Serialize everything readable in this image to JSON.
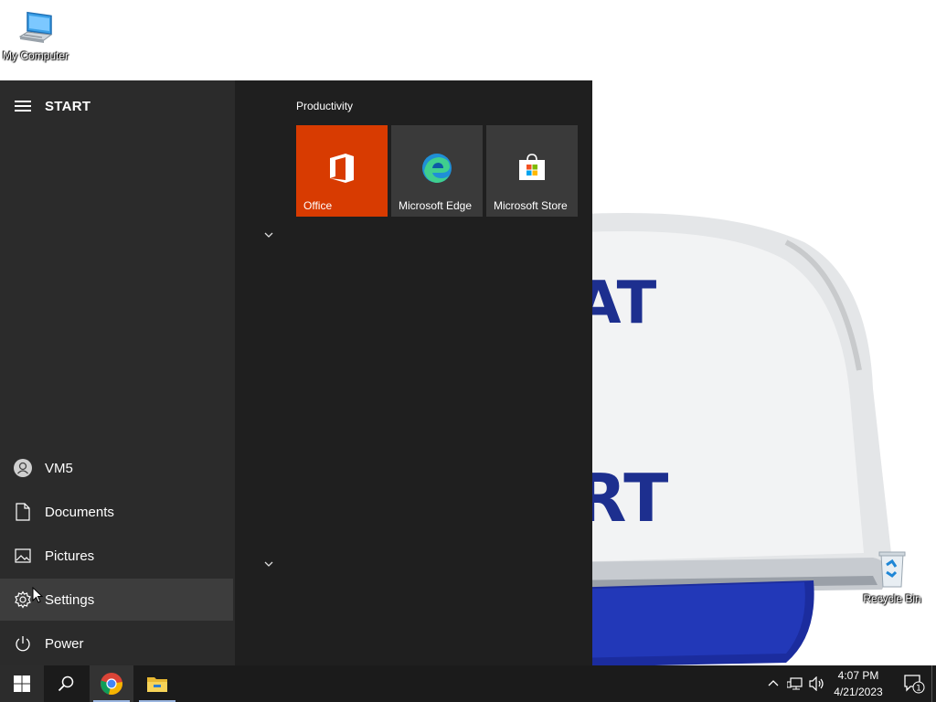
{
  "desktop": {
    "icons": [
      {
        "label": "My Computer",
        "icon": "computer-icon"
      },
      {
        "label": "Recycle Bin",
        "icon": "recycle-bin-icon"
      }
    ],
    "wallpaper_text": [
      "AT",
      "RT"
    ]
  },
  "start_menu": {
    "title": "START",
    "user": "VM5",
    "items": [
      {
        "label": "Documents",
        "icon": "document-icon"
      },
      {
        "label": "Pictures",
        "icon": "picture-icon"
      },
      {
        "label": "Settings",
        "icon": "gear-icon"
      },
      {
        "label": "Power",
        "icon": "power-icon"
      }
    ],
    "group_title": "Productivity",
    "tiles": [
      {
        "label": "Office",
        "icon": "office-icon",
        "color": "#d83b01"
      },
      {
        "label": "Microsoft Edge",
        "icon": "edge-icon",
        "color": "#3a3a3a"
      },
      {
        "label": "Microsoft Store",
        "icon": "store-icon",
        "color": "#3a3a3a"
      }
    ]
  },
  "taskbar": {
    "apps": [
      "windows-start-icon",
      "search-icon",
      "chrome-icon",
      "file-explorer-icon"
    ],
    "tray": [
      "chevron-up-icon",
      "network-icon",
      "volume-icon"
    ],
    "time": "4:07 PM",
    "date": "4/21/2023",
    "notification_count": "1"
  },
  "colors": {
    "accent": "#d83b01",
    "start_left": "#2b2b2b",
    "start_right": "#1f1f1f",
    "taskbar": "#1b1b1b"
  }
}
